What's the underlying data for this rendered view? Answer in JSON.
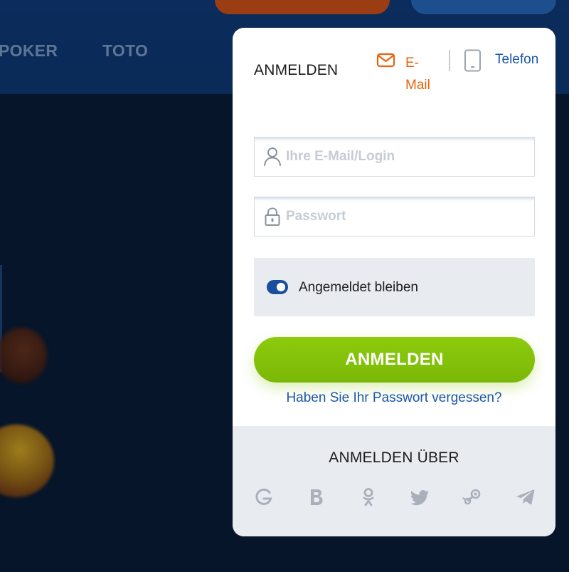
{
  "background": {
    "nav_items": [
      "POKER",
      "TOTO"
    ]
  },
  "modal": {
    "title": "ANMELDEN",
    "tabs": {
      "email_label": "E-Mail",
      "phone_label": "Telefon"
    },
    "login_field": {
      "placeholder": "Ihre E-Mail/Login",
      "value": ""
    },
    "password_field": {
      "placeholder": "Passwort",
      "value": ""
    },
    "remember": {
      "label": "Angemeldet bleiben",
      "checked": true
    },
    "submit_label": "ANMELDEN",
    "forgot_link": "Haben Sie Ihr Passwort vergessen?",
    "social": {
      "title": "ANMELDEN ÜBER",
      "providers": [
        "google-icon",
        "b-icon",
        "odnoklassniki-icon",
        "twitter-icon",
        "steam-icon",
        "telegram-icon"
      ]
    }
  },
  "colors": {
    "accent_orange": "#e8630a",
    "link_blue": "#1b56a8",
    "button_green": "#8dcb0e",
    "toggle_blue": "#1a4f9b",
    "page_bg": "#06162e"
  }
}
